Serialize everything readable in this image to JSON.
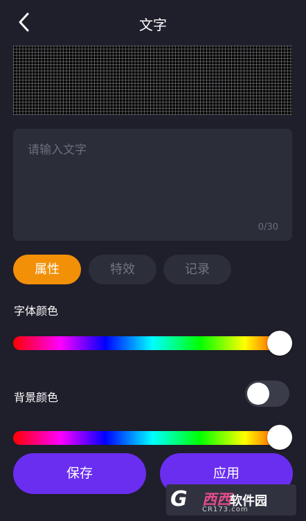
{
  "header": {
    "title": "文字",
    "back_icon": "chevron-left-icon"
  },
  "text_input": {
    "placeholder": "请输入文字",
    "value": "",
    "counter": "0/30"
  },
  "tabs": [
    {
      "label": "属性",
      "active": true
    },
    {
      "label": "特效",
      "active": false
    },
    {
      "label": "记录",
      "active": false
    }
  ],
  "font_color": {
    "label": "字体颜色",
    "hue_position": 1.0
  },
  "background_color": {
    "label": "背景颜色",
    "enabled": false,
    "hue_position": 1.0
  },
  "buttons": {
    "save": "保存",
    "apply": "应用"
  },
  "watermark": {
    "logo": "G",
    "brand_a": "西西",
    "brand_b": "软件园",
    "url": "CR173.com"
  },
  "colors": {
    "background": "#1f1e2b",
    "panel": "#2b2d39",
    "accent_orange": "#f29008",
    "primary_purple": "#6a2ef0",
    "muted_text": "#6c6f7b"
  }
}
